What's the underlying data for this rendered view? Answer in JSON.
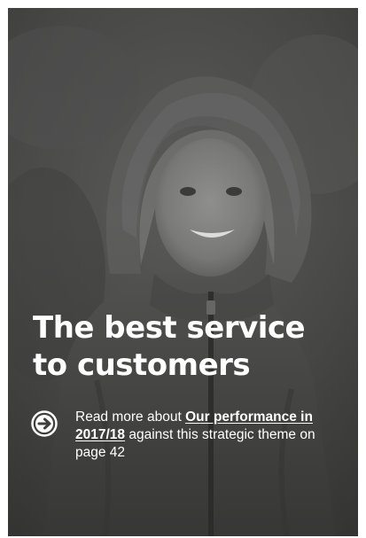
{
  "card": {
    "headline_line1": "The best service",
    "headline_line2": "to customers",
    "readmore": {
      "prefix": "Read more about ",
      "link_text": "Our performance in 2017/18",
      "suffix": " against this strategic theme on page 42"
    },
    "icons": {
      "arrow": "arrow-right-circle-icon"
    }
  },
  "colors": {
    "text": "#ffffff",
    "photo_tint": "#4a4a49"
  }
}
